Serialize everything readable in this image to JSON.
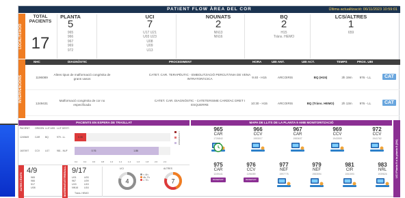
{
  "header": {
    "title": "PATIENT FLOW ÀREA DEL COR",
    "updated": "Última actualització: 06/11/2023 10:59:01"
  },
  "localitzacio": {
    "side_label": "LOCALITZACIÓ",
    "total_label": "TOTAL PACIENTS",
    "total_value": "17",
    "columns": [
      {
        "label": "PLANTA",
        "count": "5",
        "items": [
          "965",
          "966",
          "967",
          "969",
          "972"
        ]
      },
      {
        "label": "UCI",
        "count": "7",
        "items": [
          "U17 U21",
          "U03 U23",
          "U08",
          "U09",
          "U13"
        ]
      },
      {
        "label": "NOUNATS",
        "count": "2",
        "items": [
          "NN13",
          "NN16"
        ]
      },
      {
        "label": "BQ",
        "count": "2",
        "items": [
          "H15",
          "Tràns. HEMO"
        ]
      },
      {
        "label": "LCS/ALTRES",
        "count": "1",
        "items": [
          "659"
        ]
      }
    ]
  },
  "intervencions": {
    "side_label": "INTERVENCIONS",
    "headers": {
      "nhc": "NHC",
      "diag": "DIAGNÒSTIC",
      "proc": "PROCEDIMENT",
      "hora": "HORA",
      "ubi_ant": "UBI ANT.",
      "ubi_act": "UBI ACT.",
      "temps": "TEMPS",
      "prox": "PROX. UBI"
    },
    "rows": [
      {
        "nhc": "1196089",
        "diag": "Altres tipus de malformació congènita de grans vasos",
        "proc": "CATET. CAR. TERAPÈUTIC - EMBOLITZACIÓ PERCUTÀNIA DE VENA INTRATORÀCICA",
        "hora": "9:40 - H15",
        "ubi_ant": "ARCOIRIS",
        "ubi_act": "BQ (H15)",
        "temps": "3h 19m",
        "prox": "976 - LL",
        "action": "CAT"
      },
      {
        "nhc": "1249431",
        "diag": "Malformació congènita de cor no especificada",
        "proc": "CATET. CAR. DIAGNÒSTIC - CATETERISME CARDÍAC DRET I ESQUERRE",
        "hora": "10:30 - H15",
        "ubi_ant": "ARCOIRIS",
        "ubi_act": "BQ (Tràns. HEMO)",
        "temps": "2h 13m",
        "prox": "976 - LL",
        "action": "CAT"
      }
    ]
  },
  "trasllat": {
    "title": "PACIENTS EN ESPERA DE TRASLLAT",
    "headers": [
      "PACIENT",
      "ORIGEN",
      "LLIT ASS.",
      "LLIT DESTÍ"
    ],
    "rows": [
      {
        "pacient": "1249469",
        "origen": "CAR",
        "llit": "BQ",
        "desti": "979 - LL",
        "bar_label": "0.35",
        "bar_frac": 0.12
      },
      {
        "pacient": "1607497",
        "origen": "CCV",
        "llit": "U17",
        "desti": "981 - NUF",
        "bar_label": "0.76",
        "bar_label2": "1.86",
        "bar_frac": 0.4,
        "bar_frac2": 0.88
      }
    ],
    "axis": [
      "0.2",
      "0.4",
      "0.6",
      "0.8",
      "1.0",
      "1.2",
      "1.4",
      "1.6",
      "1.8",
      "2.0",
      "2.2"
    ],
    "legend": [
      "< 2h D'ESPERA",
      "2h-4h D'ESPERA",
      "> 4h D'ESPERA"
    ]
  },
  "ocupacio": {
    "side_label_1": "ALTES I ÉXITS",
    "side_label_2": "MATERNITAT/TREBALL",
    "left_value": "4/9",
    "left_items": [
      "965",
      "966",
      "517",
      "U08"
    ],
    "mid_value": "9/17",
    "mid_items": [
      [
        "U01",
        "U03"
      ],
      [
        "967",
        "U09"
      ],
      [
        "U15",
        "U15"
      ],
      [
        "NN16",
        "U16"
      ]
    ],
    "mid_note": "Tràns. HEMO",
    "uci_label": "UCI",
    "uci_value": "4",
    "altres_label": "ALTRES",
    "altres_value": "7",
    "legend": [
      "< 4h",
      "4h-7h",
      "> 7h"
    ]
  },
  "mapa": {
    "title": "MAPA DE LLITS DE LA PLANTA 9 AMB MONITORITZACIÓ",
    "side_label": "UCI Planta 9 a la planta 8 (2/4)",
    "row1": [
      {
        "num": "965",
        "tag": "CAR",
        "id": "1726842"
      },
      {
        "num": "966",
        "tag": "CCV",
        "id": "1953017"
      },
      {
        "num": "967",
        "tag": "CAR",
        "id": "1983637"
      },
      {
        "num": "969",
        "tag": "CCV",
        "id": "1943559"
      },
      {
        "num": "972",
        "tag": "CCV",
        "id": "1941762"
      }
    ],
    "row2": [
      {
        "num": "975",
        "tag": "CAR",
        "id": "1249441",
        "badge": "RESERVAT"
      },
      {
        "num": "976",
        "tag": "CCV",
        "id": "1196089",
        "badge": "RESERVAT"
      },
      {
        "num": "977",
        "tag": "NEF",
        "id": "1997775"
      },
      {
        "num": "979",
        "tag": "NEF",
        "id": "1983594"
      },
      {
        "num": "981",
        "tag": "CIR",
        "id": "1061593"
      },
      {
        "num": "983",
        "tag": "NRL",
        "id": "1939826"
      }
    ]
  },
  "colors": {
    "orange": "#f07d22",
    "navy": "#1b3350",
    "purple": "#8b2f93",
    "cat_blue": "#69a6de",
    "red": "#dd3a3a"
  }
}
